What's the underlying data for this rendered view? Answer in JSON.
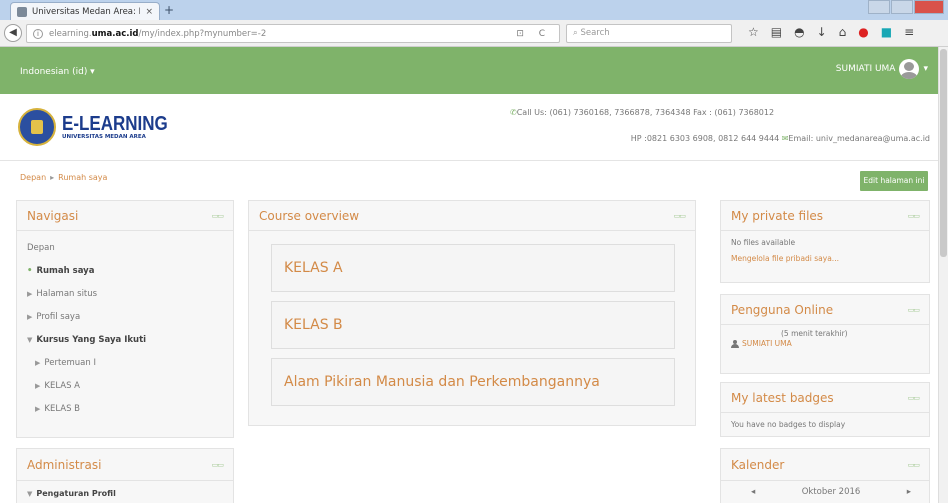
{
  "browser": {
    "tab_title": "Universitas Medan Area: R...",
    "tab_close": "×",
    "new_tab": "+",
    "url_prefix": "elearning.",
    "url_host": "uma.ac.id",
    "url_path": "/my/index.php?mynumber=-2",
    "search_placeholder": "Search",
    "url_tools": "⊡ C"
  },
  "site": {
    "language": "Indonesian (id) ▾",
    "user": "SUMIATI UMA",
    "brand_title": "E-LEARNING",
    "brand_sub": "UNIVERSITAS MEDAN AREA",
    "contact_line1": "Call Us: (061) 7360168, 7366878, 7364348 Fax : (061) 7368012",
    "contact_line2": "HP :0821 6303 6908, 0812 644 9444",
    "contact_email": "Email: univ_medanarea@uma.ac.id"
  },
  "breadcrumb": {
    "home": "Depan",
    "sep": "▸",
    "current": "Rumah saya"
  },
  "edit_button": "Edit halaman ini",
  "navigasi": {
    "title": "Navigasi",
    "dock": "▭▭",
    "items": {
      "depan": "Depan",
      "rumah": "Rumah saya",
      "halaman": "Halaman situs",
      "profil": "Profil saya",
      "kursus": "Kursus Yang Saya Ikuti",
      "pertemuan": "Pertemuan I",
      "kelas_a": "KELAS A",
      "kelas_b": "KELAS B"
    }
  },
  "administrasi": {
    "title": "Administrasi",
    "dock": "▭▭",
    "first_item": "Pengaturan Profil"
  },
  "course_overview": {
    "title": "Course overview",
    "dock": "▭▭",
    "courses": [
      "KELAS A",
      "KELAS B",
      "Alam Pikiran Manusia dan Perkembangannya"
    ]
  },
  "private_files": {
    "title": "My private files",
    "dock": "▭▭",
    "empty": "No files available",
    "manage": "Mengelola file pribadi saya..."
  },
  "online_users": {
    "title": "Pengguna Online",
    "dock": "▭▭",
    "period": "(5 menit terakhir)",
    "user": "SUMIATI UMA"
  },
  "badges": {
    "title": "My latest badges",
    "dock": "▭▭",
    "empty": "You have no badges to display"
  },
  "calendar": {
    "title": "Kalender",
    "dock": "▭▭",
    "prev": "◂",
    "month": "Oktober 2016",
    "next": "▸"
  },
  "colors": {
    "accent_green": "#7fb36a",
    "link_orange": "#d38a47"
  }
}
